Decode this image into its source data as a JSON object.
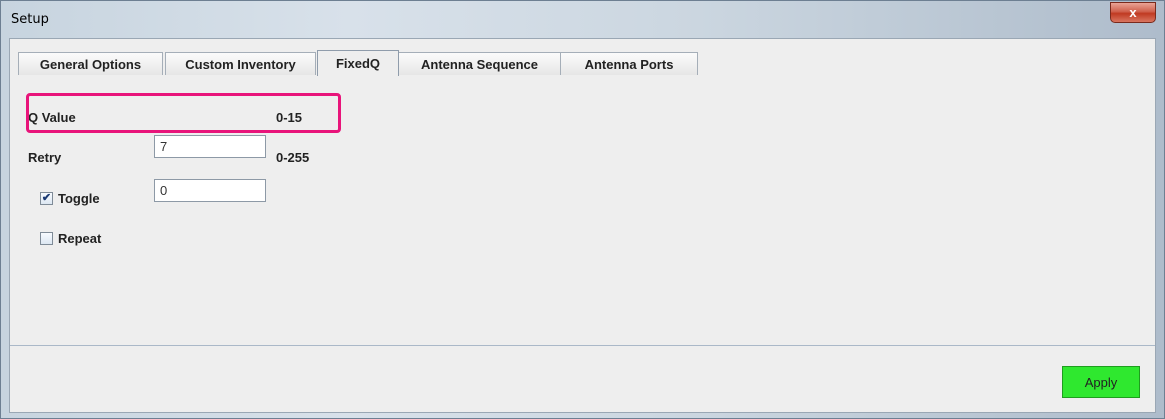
{
  "window": {
    "title": "Setup",
    "close_symbol": "x"
  },
  "tabs": [
    {
      "label": "General Options",
      "active": false
    },
    {
      "label": "Custom Inventory",
      "active": false
    },
    {
      "label": "FixedQ",
      "active": true
    },
    {
      "label": "Antenna Sequence",
      "active": false
    },
    {
      "label": "Antenna Ports",
      "active": false
    }
  ],
  "fixedq": {
    "q_value": {
      "label": "Q Value",
      "value": "7",
      "range": "0-15"
    },
    "retry": {
      "label": "Retry",
      "value": "0",
      "range": "0-255"
    },
    "toggle": {
      "label": "Toggle",
      "checked": true,
      "check_mark": "✔"
    },
    "repeat": {
      "label": "Repeat",
      "checked": false
    }
  },
  "footer": {
    "apply_label": "Apply"
  },
  "colors": {
    "highlight": "#e8147a",
    "apply_bg": "#2fe82f",
    "close_bg": "#c8422b"
  }
}
